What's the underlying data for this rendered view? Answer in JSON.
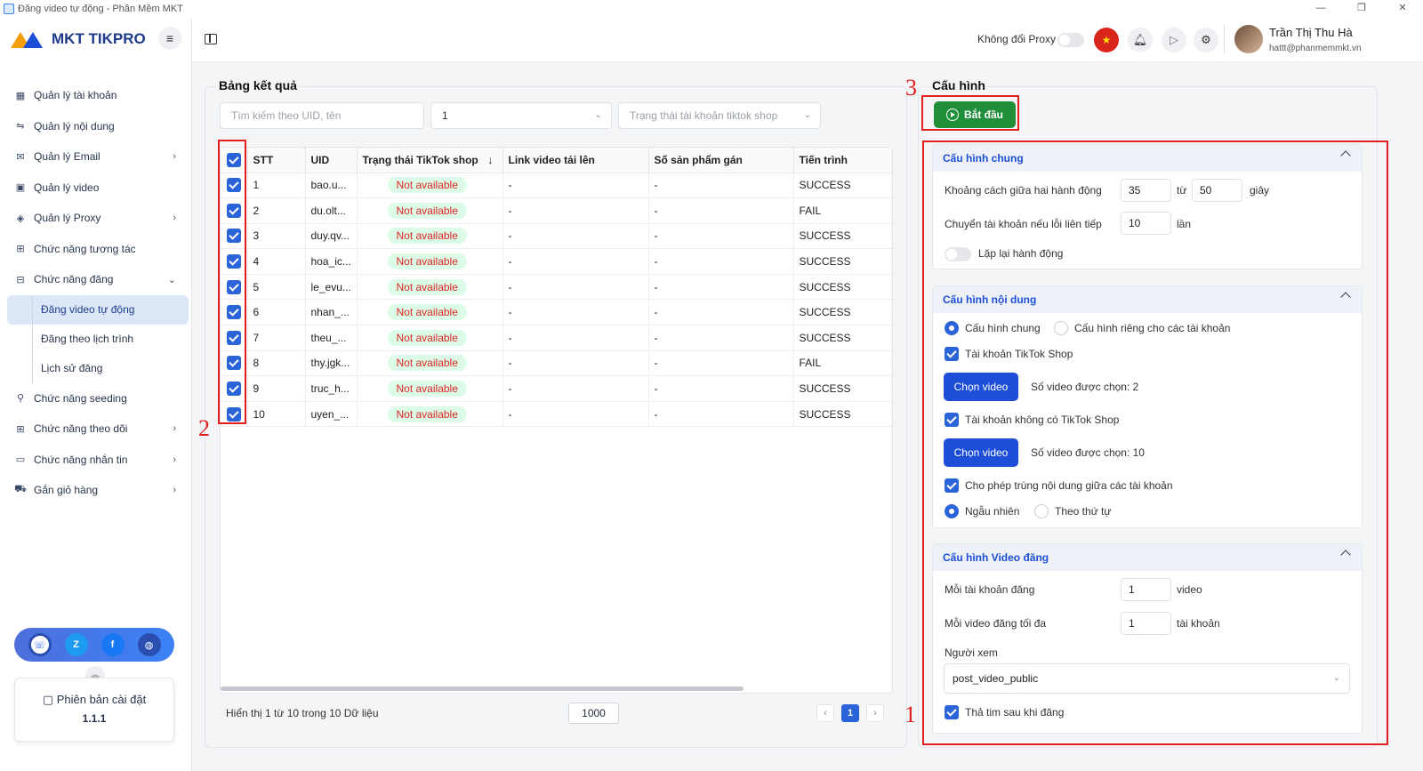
{
  "window": {
    "title": "Đăng video tự động - Phần Mềm MKT"
  },
  "brand": {
    "name": "MKT TIKPRO"
  },
  "sidebar": {
    "items": [
      {
        "label": "Quản lý tài khoản",
        "icon": "grid-icon"
      },
      {
        "label": "Quản lý nội dung",
        "icon": "content-icon"
      },
      {
        "label": "Quản lý Email",
        "icon": "mail-icon"
      },
      {
        "label": "Quản lý video",
        "icon": "video-icon"
      },
      {
        "label": "Quản lý Proxy",
        "icon": "layers-icon"
      },
      {
        "label": "Chức năng tương tác",
        "icon": "interact-icon"
      },
      {
        "label": "Chức năng đăng",
        "icon": "post-icon"
      }
    ],
    "sub_items": [
      {
        "label": "Đăng video tự động"
      },
      {
        "label": "Đăng theo lịch trình"
      },
      {
        "label": "Lịch sử đăng"
      }
    ],
    "items2": [
      {
        "label": "Chức năng seeding",
        "icon": "seeding-icon"
      },
      {
        "label": "Chức năng theo dõi",
        "icon": "follow-icon"
      },
      {
        "label": "Chức năng nhắn tin",
        "icon": "chat-icon"
      },
      {
        "label": "Gắn giỏ hàng",
        "icon": "cart-icon"
      }
    ],
    "version_label": "Phiên bản cài đặt",
    "version": "1.1.1"
  },
  "topbar": {
    "proxy_label": "Không đổi Proxy",
    "user_name": "Trần Thị Thu Hà",
    "user_email": "hattt@phanmemmkt.vn"
  },
  "results": {
    "title": "Bảng kết quả",
    "search_placeholder": "Tìm kiếm theo UID, tên",
    "filter_value": "1",
    "status_placeholder": "Trạng thái tài khoản tiktok shop",
    "columns": [
      "STT",
      "UID",
      "Trạng thái TikTok shop",
      "Link video tải lên",
      "Số sản phẩm gán",
      "Tiến trình"
    ],
    "rows": [
      {
        "stt": "1",
        "uid": "bao.u...",
        "status": "Not available",
        "link": "-",
        "products": "-",
        "progress": "SUCCESS"
      },
      {
        "stt": "2",
        "uid": "du.olt...",
        "status": "Not available",
        "link": "-",
        "products": "-",
        "progress": "FAIL"
      },
      {
        "stt": "3",
        "uid": "duy.qv...",
        "status": "Not available",
        "link": "-",
        "products": "-",
        "progress": "SUCCESS"
      },
      {
        "stt": "4",
        "uid": "hoa_ic...",
        "status": "Not available",
        "link": "-",
        "products": "-",
        "progress": "SUCCESS"
      },
      {
        "stt": "5",
        "uid": "le_evu...",
        "status": "Not available",
        "link": "-",
        "products": "-",
        "progress": "SUCCESS"
      },
      {
        "stt": "6",
        "uid": "nhan_...",
        "status": "Not available",
        "link": "-",
        "products": "-",
        "progress": "SUCCESS"
      },
      {
        "stt": "7",
        "uid": "theu_...",
        "status": "Not available",
        "link": "-",
        "products": "-",
        "progress": "SUCCESS"
      },
      {
        "stt": "8",
        "uid": "thy.jgk...",
        "status": "Not available",
        "link": "-",
        "products": "-",
        "progress": "FAIL"
      },
      {
        "stt": "9",
        "uid": "truc_h...",
        "status": "Not available",
        "link": "-",
        "products": "-",
        "progress": "SUCCESS"
      },
      {
        "stt": "10",
        "uid": "uyen_...",
        "status": "Not available",
        "link": "-",
        "products": "-",
        "progress": "SUCCESS"
      }
    ],
    "footer_info": "Hiển thị 1 từ 10 trong 10 Dữ liệu",
    "page_size": "1000",
    "current_page": "1"
  },
  "config": {
    "title": "Cấu hình",
    "start_label": "Bắt đầu",
    "general": {
      "title": "Cấu hình chung",
      "delay_label": "Khoảng cách giữa hai hành động",
      "delay_from": "35",
      "from_word": "từ",
      "delay_to": "50",
      "unit_sec": "giây",
      "switch_label": "Chuyển tài khoản nếu lỗi liên tiếp",
      "switch_value": "10",
      "unit_times": "lần",
      "repeat_label": "Lặp lại hành động"
    },
    "content": {
      "title": "Cấu hình nội dung",
      "radio_general": "Cấu hình chung",
      "radio_private": "Cấu hình riêng cho các tài khoản",
      "tiktok_shop_label": "Tài khoản TikTok Shop",
      "choose_video": "Chọn video",
      "selected_1": "Số video được chọn: 2",
      "no_shop_label": "Tài khoản không có TikTok Shop",
      "selected_2": "Số video được chọn: 10",
      "allow_dup_label": "Cho phép trùng nội dung giữa các tài khoản",
      "random_label": "Ngẫu nhiên",
      "order_label": "Theo thứ tự"
    },
    "video": {
      "title": "Cấu hình Video đăng",
      "per_account_label": "Mỗi tài khoản đăng",
      "per_account_value": "1",
      "unit_video": "video",
      "max_label": "Mỗi video đăng tối đa",
      "max_value": "1",
      "unit_account": "tài khoản",
      "viewer_label": "Người xem",
      "viewer_value": "post_video_public",
      "heart_label": "Thả tim sau khi đăng"
    }
  },
  "annotations": {
    "n1": "1",
    "n2": "2",
    "n3": "3"
  }
}
